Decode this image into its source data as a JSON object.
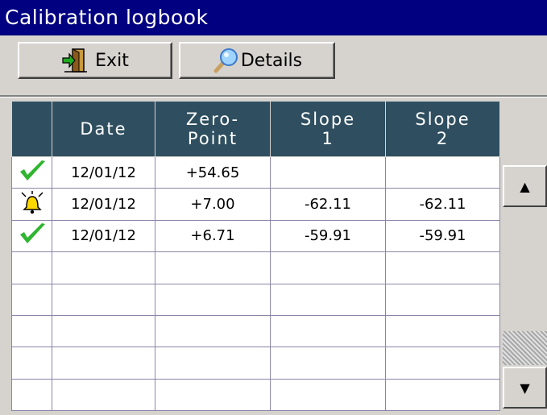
{
  "window": {
    "title": "Calibration logbook"
  },
  "toolbar": {
    "exit_label": "Exit",
    "details_label": "Details",
    "exit_icon": "door-exit-icon",
    "details_icon": "magnifier-icon"
  },
  "table": {
    "columns": [
      "",
      "Date",
      "Zero-\nPoint",
      "Slope\n1",
      "Slope\n2"
    ],
    "rows": [
      {
        "status": "check",
        "date": "12/01/12",
        "zero_point": "+54.65",
        "slope1": "",
        "slope2": ""
      },
      {
        "status": "alarm",
        "date": "12/01/12",
        "zero_point": "+7.00",
        "slope1": "-62.11",
        "slope2": "-62.11"
      },
      {
        "status": "check",
        "date": "12/01/12",
        "zero_point": "+6.71",
        "slope1": "-59.91",
        "slope2": "-59.91"
      },
      {
        "status": "",
        "date": "",
        "zero_point": "",
        "slope1": "",
        "slope2": ""
      },
      {
        "status": "",
        "date": "",
        "zero_point": "",
        "slope1": "",
        "slope2": ""
      },
      {
        "status": "",
        "date": "",
        "zero_point": "",
        "slope1": "",
        "slope2": ""
      },
      {
        "status": "",
        "date": "",
        "zero_point": "",
        "slope1": "",
        "slope2": ""
      },
      {
        "status": "",
        "date": "",
        "zero_point": "",
        "slope1": "",
        "slope2": ""
      }
    ]
  },
  "scrollbar": {
    "up_icon": "arrow-up-icon",
    "down_icon": "arrow-down-icon"
  },
  "colors": {
    "titlebar": "#000080",
    "header": "#2f4f60",
    "check": "#2fb52f",
    "alarm": "#ffd700"
  }
}
